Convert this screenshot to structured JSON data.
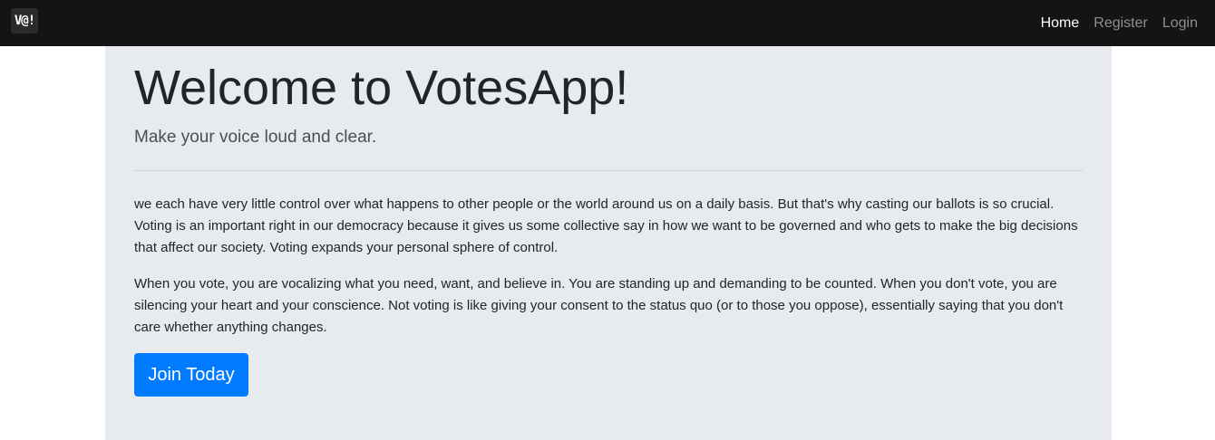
{
  "navbar": {
    "brand": "V@!",
    "links": [
      {
        "label": "Home",
        "active": true
      },
      {
        "label": "Register",
        "active": false
      },
      {
        "label": "Login",
        "active": false
      }
    ]
  },
  "hero": {
    "title": "Welcome to VotesApp!",
    "lead": "Make your voice loud and clear.",
    "paragraphs": [
      "we each have very little control over what happens to other people or the world around us on a daily basis. But that's why casting our ballots is so crucial. Voting is an important right in our democracy because it gives us some collective say in how we want to be governed and who gets to make the big decisions that affect our society. Voting expands your personal sphere of control.",
      "When you vote, you are vocalizing what you need, want, and believe in. You are standing up and demanding to be counted. When you don't vote, you are silencing your heart and your conscience. Not voting is like giving your consent to the status quo (or to those you oppose), essentially saying that you don't care whether anything changes."
    ],
    "cta_label": "Join Today"
  },
  "colors": {
    "navbar_bg": "#141414",
    "hero_bg": "#e7eaee",
    "primary": "#007bff"
  }
}
